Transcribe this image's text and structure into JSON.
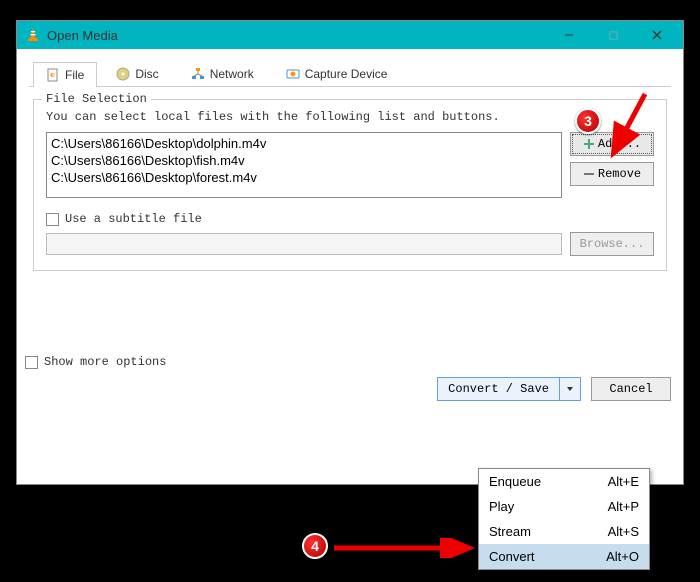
{
  "window": {
    "title": "Open Media"
  },
  "tabs": [
    {
      "label": "File",
      "icon": "file-icon"
    },
    {
      "label": "Disc",
      "icon": "disc-icon"
    },
    {
      "label": "Network",
      "icon": "network-icon"
    },
    {
      "label": "Capture Device",
      "icon": "capture-icon"
    }
  ],
  "file_selection": {
    "group_label": "File Selection",
    "help": "You can select local files with the following list and buttons.",
    "files": [
      "C:\\Users\\86166\\Desktop\\dolphin.m4v",
      "C:\\Users\\86166\\Desktop\\fish.m4v",
      "C:\\Users\\86166\\Desktop\\forest.m4v"
    ],
    "add_label": "Add...",
    "remove_label": "Remove",
    "subtitle_checkbox": "Use a subtitle file",
    "browse_label": "Browse..."
  },
  "options_checkbox": "Show more options",
  "footer": {
    "convert_save": "Convert / Save",
    "cancel": "Cancel"
  },
  "dropdown": {
    "items": [
      {
        "label": "Enqueue",
        "shortcut": "Alt+E"
      },
      {
        "label": "Play",
        "shortcut": "Alt+P"
      },
      {
        "label": "Stream",
        "shortcut": "Alt+S"
      },
      {
        "label": "Convert",
        "shortcut": "Alt+O"
      }
    ],
    "selected_index": 3
  },
  "annotations": {
    "badge3": "3",
    "badge4": "4"
  }
}
